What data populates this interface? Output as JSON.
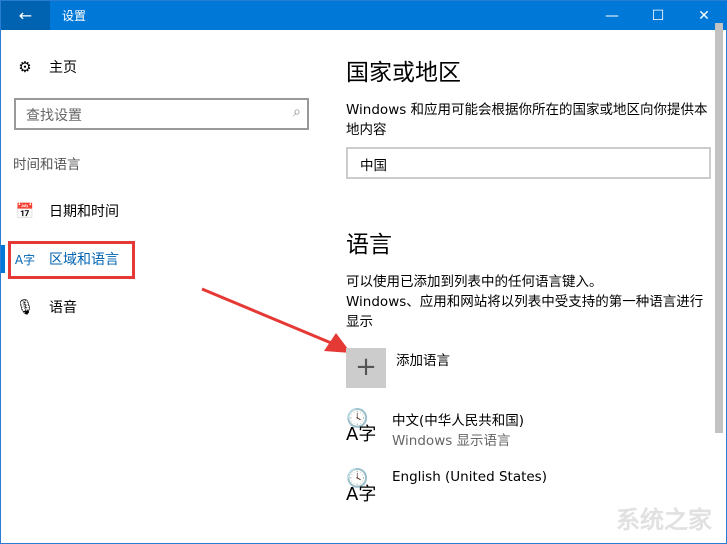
{
  "window": {
    "title": "设置",
    "back_icon": "arrow-left-icon",
    "minimize": "—",
    "maximize": "☐",
    "close": "✕"
  },
  "sidebar": {
    "home": "主页",
    "search_placeholder": "查找设置",
    "section": "时间和语言",
    "items": [
      {
        "label": "日期和时间",
        "icon": "calendar-clock-icon"
      },
      {
        "label": "区域和语言",
        "icon": "language-icon",
        "selected": true
      },
      {
        "label": "语音",
        "icon": "microphone-icon"
      }
    ]
  },
  "main": {
    "region_heading": "国家或地区",
    "region_desc": "Windows 和应用可能会根据你所在的国家或地区向你提供本地内容",
    "region_value": "中国",
    "language_heading": "语言",
    "language_desc1": "可以使用已添加到列表中的任何语言键入。",
    "language_desc2": "Windows、应用和网站将以列表中受支持的第一种语言进行显示",
    "add_language": "添加语言",
    "languages": [
      {
        "name": "中文(中华人民共和国)",
        "sub": "Windows 显示语言"
      },
      {
        "name": "English (United States)",
        "sub": ""
      }
    ]
  },
  "watermark": "系统之家",
  "colors": {
    "accent": "#0078d7",
    "annotation": "#e53935"
  }
}
